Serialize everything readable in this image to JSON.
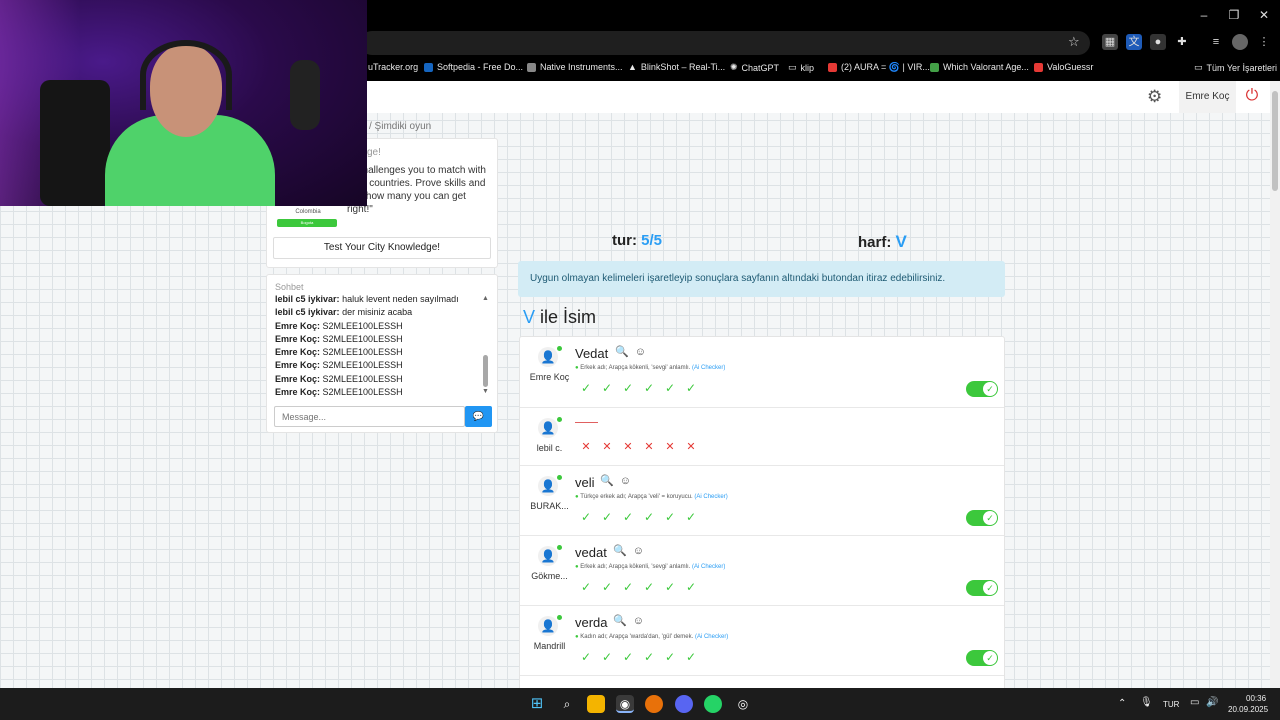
{
  "bookmarks": [
    {
      "label": "uTracker.org",
      "color": "#000000"
    },
    {
      "label": "Softpedia - Free Do...",
      "color": "#1565c0"
    },
    {
      "label": "Native Instruments...",
      "color": "#888888"
    },
    {
      "label": "BlinkShot – Real-Ti...",
      "color": "#dddddd"
    },
    {
      "label": "ChatGPT",
      "color": "#dddddd"
    },
    {
      "label": "klip",
      "color": "#dddddd"
    },
    {
      "label": "(2) AURA = 🌀 | VIR...",
      "color": "#e53935"
    },
    {
      "label": "Which Valorant Age...",
      "color": "#43a047"
    },
    {
      "label": "ValoGuessr",
      "color": "#e53935"
    },
    {
      "label": "Tüm Yer İşaretleri",
      "color": "#dddddd"
    }
  ],
  "header": {
    "user_name": "Emre Koç"
  },
  "breadcrumb": "/  Şimdiki oyun",
  "challenge": {
    "title": "ge!",
    "description": "lo challenges you to match with their countries. Prove skills and see how many you can get right!\"",
    "country": "Colombia",
    "country_bar": "Bogota",
    "button": "Test Your City Knowledge!"
  },
  "chat": {
    "title": "Sohbet",
    "messages": [
      {
        "user": "lebil c5 iykivar:",
        "text": "haluk levent neden sayılmadı"
      },
      {
        "user": "lebil c5 iykivar:",
        "text": "der misiniz acaba"
      },
      {
        "user": "Emre Koç:",
        "text": "S2MLEE100LESSH"
      },
      {
        "user": "Emre Koç:",
        "text": "S2MLEE100LESSH"
      },
      {
        "user": "Emre Koç:",
        "text": "S2MLEE100LESSH"
      },
      {
        "user": "Emre Koç:",
        "text": "S2MLEE100LESSH"
      },
      {
        "user": "Emre Koç:",
        "text": "S2MLEE100LESSH"
      },
      {
        "user": "Emre Koç:",
        "text": "S2MLEE100LESSH"
      }
    ],
    "placeholder": "Message..."
  },
  "game": {
    "round_label": "tur:",
    "round_value": "5/5",
    "letter_label": "harf:",
    "letter_value": "V",
    "info": "Uygun olmayan kelimeleri işaretleyip sonuçlara sayfanın altındaki butondan itiraz edebilirsiniz.",
    "category_letter": "V",
    "category_name": "ile İsim"
  },
  "answers": [
    {
      "player": "Emre Koç",
      "word": "Vedat",
      "note": "Erkek adı; Arapça kökenli, 'sevgi' anlamlı.",
      "ai": "(Ai Checker)",
      "votes": [
        "yes",
        "yes",
        "yes",
        "yes",
        "yes",
        "yes"
      ],
      "accepted": true
    },
    {
      "player": "lebil c.",
      "word": "",
      "note": "",
      "ai": "",
      "votes": [
        "no",
        "no",
        "no",
        "no",
        "no",
        "no"
      ],
      "accepted": false
    },
    {
      "player": "BURAK...",
      "word": "veli",
      "note": "Türkçe erkek adı; Arapça 'veli' = koruyucu.",
      "ai": "(Ai Checker)",
      "votes": [
        "yes",
        "yes",
        "yes",
        "yes",
        "yes",
        "yes"
      ],
      "accepted": true
    },
    {
      "player": "Gökme...",
      "word": "vedat",
      "note": "Erkek adı; Arapça kökenli, 'sevgi' anlamlı.",
      "ai": "(Ai Checker)",
      "votes": [
        "yes",
        "yes",
        "yes",
        "yes",
        "yes",
        "yes"
      ],
      "accepted": true
    },
    {
      "player": "Mandrill",
      "word": "verda",
      "note": "Kadın adı; Arapça 'warda'dan, 'gül' demek.",
      "ai": "(Ai Checker)",
      "votes": [
        "yes",
        "yes",
        "yes",
        "yes",
        "yes",
        "yes"
      ],
      "accepted": true
    }
  ],
  "taskbar": {
    "language": "TUR",
    "time": "00:36",
    "date": "20.09.2025"
  }
}
